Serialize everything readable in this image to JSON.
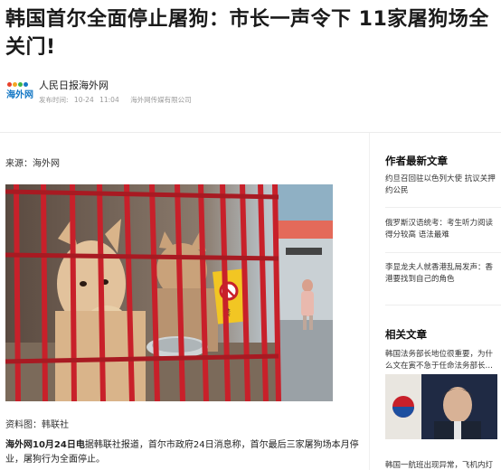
{
  "article": {
    "headline": "韩国首尔全面停止屠狗：市长一声令下 11家屠狗场全关门!",
    "author": {
      "name": "人民日报海外网",
      "logo_text": "海外网",
      "publish_label": "发布时间:",
      "date": "10-24",
      "time": "11:04",
      "company": "海外网传媒有限公司"
    },
    "source": "来源：海外网",
    "photo_sign": "禁",
    "caption": "资料图：韩联社",
    "body_lead": "海外网10月24日电",
    "body_text": "据韩联社报道，首尔市政府24日消息称，首尔最后三家屠狗场本月停业，屠狗行为全面停止。"
  },
  "sidebar": {
    "latest_title": "作者最新文章",
    "latest_items": [
      "约旦召回驻以色列大使 抗议关押约公民",
      "俄罗斯汉语统考：考生听力阅读得分较高 语法最难",
      "李显龙夫人就香港乱局发声：香港要找到自己的角色"
    ],
    "related_title": "相关文章",
    "related_items": [
      "韩国法务部长地位很重要，为什么文在寅不急于任命法务部长…",
      "韩国一航班出现异常，飞机内灯"
    ]
  },
  "colors": {
    "logo_blue": "#1578c5",
    "cage_red": "#c8202a",
    "text_dark": "#1a1a1a",
    "meta_grey": "#9a9a9a"
  },
  "icons": {
    "logo": "haiwainet-logo-icon"
  }
}
